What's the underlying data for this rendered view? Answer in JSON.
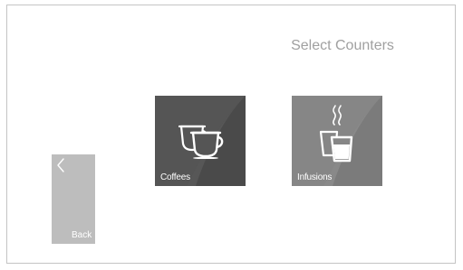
{
  "screen": {
    "title": "Select Counters"
  },
  "back": {
    "label": "Back",
    "icon": "chevron-left-icon"
  },
  "tiles": [
    {
      "label": "Coffees",
      "icon": "coffee-cups-icon"
    },
    {
      "label": "Infusions",
      "icon": "tea-glasses-icon"
    }
  ],
  "colors": {
    "coffees_tile": "#555555",
    "infusions_tile": "#868686",
    "back_button": "#bdbdbd",
    "title_text": "#a0a0a0"
  }
}
